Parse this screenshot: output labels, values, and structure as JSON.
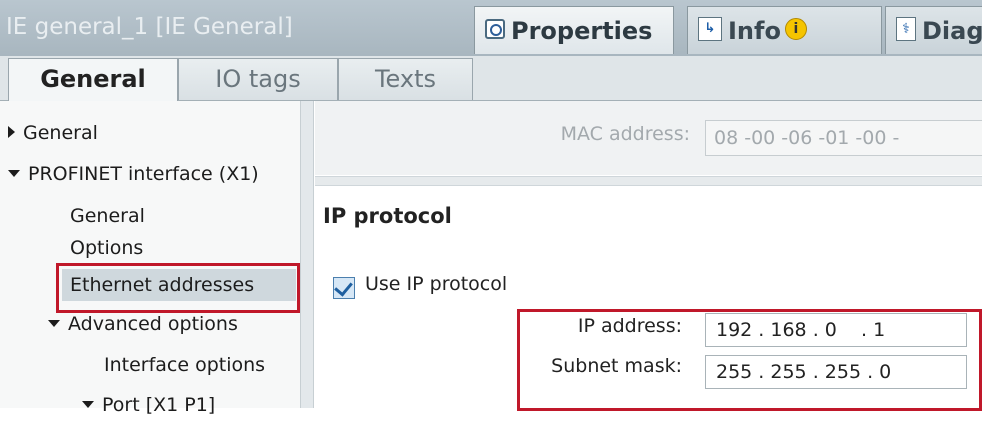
{
  "window": {
    "title": "IE general_1 [IE General]"
  },
  "panel_tabs": {
    "properties": "Properties",
    "info": "Info",
    "info_badge": "i",
    "diagnostics": "Diagno"
  },
  "sub_tabs": [
    {
      "label": "General",
      "active": true
    },
    {
      "label": "IO tags",
      "active": false
    },
    {
      "label": "Texts",
      "active": false
    }
  ],
  "tree": {
    "items": [
      {
        "label": "General",
        "expand": "collapsed",
        "level": 0
      },
      {
        "label": "PROFINET interface (X1)",
        "expand": "expanded",
        "level": 0
      },
      {
        "label": "General",
        "expand": "none",
        "level": 1
      },
      {
        "label": "Options",
        "expand": "none",
        "level": 1
      },
      {
        "label": "Ethernet addresses",
        "expand": "none",
        "level": 1,
        "selected": true
      },
      {
        "label": "Advanced options",
        "expand": "expanded",
        "level": 1
      },
      {
        "label": "Interface options",
        "expand": "none",
        "level": 2
      },
      {
        "label": "Port [X1 P1]",
        "expand": "expanded",
        "level": 2
      }
    ]
  },
  "content": {
    "mac_label": "MAC address:",
    "mac_value": "08 -00 -06 -01 -00 -",
    "section_title": "IP protocol",
    "use_ip_label": "Use IP protocol",
    "use_ip_checked": true,
    "ip_label": "IP address:",
    "ip_value": "192 . 168 . 0    . 1",
    "subnet_label": "Subnet mask:",
    "subnet_value": "255 . 255 . 255 . 0"
  },
  "colors": {
    "highlight_box": "#c0182a",
    "title_bar": "#b9c6cf"
  }
}
